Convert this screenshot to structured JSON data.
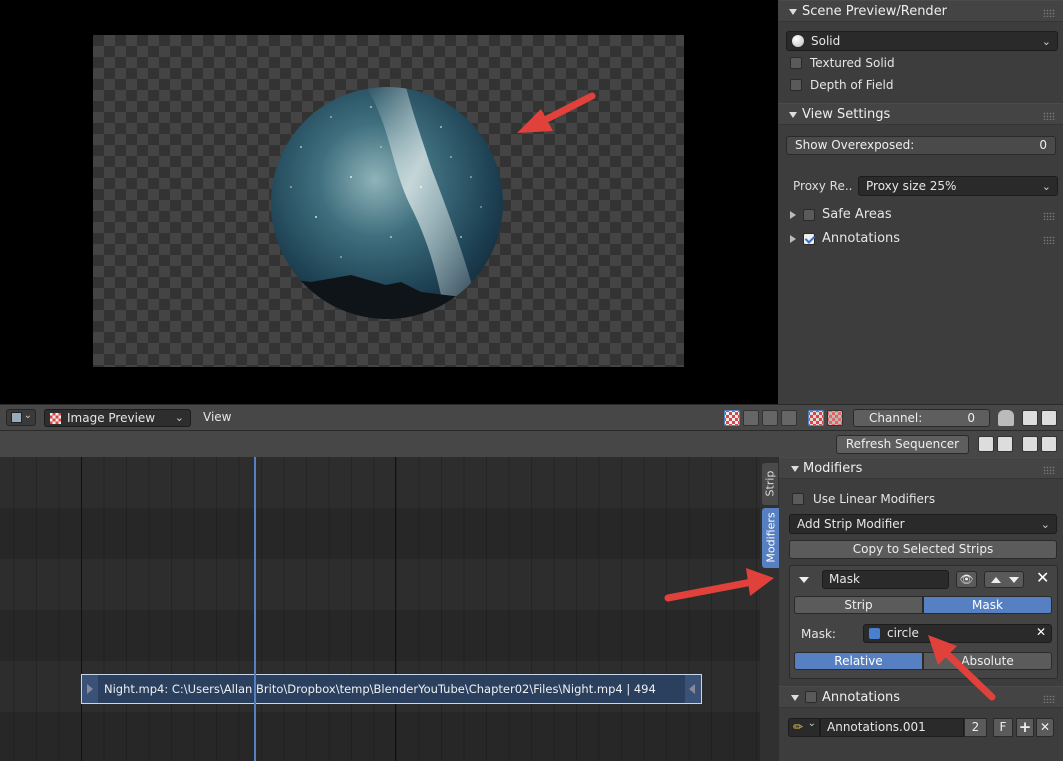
{
  "preview_panel": {
    "scene_section": {
      "title": "Scene Preview/Render",
      "display_mode": "Solid",
      "textured_solid_label": "Textured Solid",
      "depth_of_field_label": "Depth of Field"
    },
    "view_settings": {
      "title": "View Settings",
      "show_overexposed_label": "Show Overexposed:",
      "show_overexposed_value": "0",
      "proxy_label": "Proxy Re..",
      "proxy_value": "Proxy size 25%",
      "safe_areas_label": "Safe Areas",
      "annotations_label": "Annotations",
      "annotations_checked": true
    }
  },
  "preview_header": {
    "mode_label": "Image Preview",
    "view_menu": "View",
    "channel_label": "Channel:",
    "channel_value": "0"
  },
  "sequencer_header": {
    "refresh_button": "Refresh Sequencer"
  },
  "side_tabs": {
    "strip": "Strip",
    "modifiers": "Modifiers"
  },
  "modifiers_panel": {
    "title": "Modifiers",
    "use_linear_label": "Use Linear Modifiers",
    "add_modifier": "Add Strip Modifier",
    "copy_button": "Copy to Selected Strips",
    "modifier": {
      "name": "Mask",
      "tab_strip": "Strip",
      "tab_mask": "Mask",
      "mask_label": "Mask:",
      "mask_value": "circle",
      "tab_relative": "Relative",
      "tab_absolute": "Absolute"
    }
  },
  "annotations_panel": {
    "title": "Annotations",
    "layer_name": "Annotations.001",
    "users": "2",
    "fake_user": "F"
  },
  "strip": {
    "label": "Night.mp4: C:\\Users\\Allan Brito\\Dropbox\\temp\\BlenderYouTube\\Chapter02\\Files\\Night.mp4 | 494"
  },
  "colors": {
    "accent_blue": "#5680c2",
    "annotation_arrow": "#e0413a",
    "strip_fill": "#2b3f5e"
  }
}
